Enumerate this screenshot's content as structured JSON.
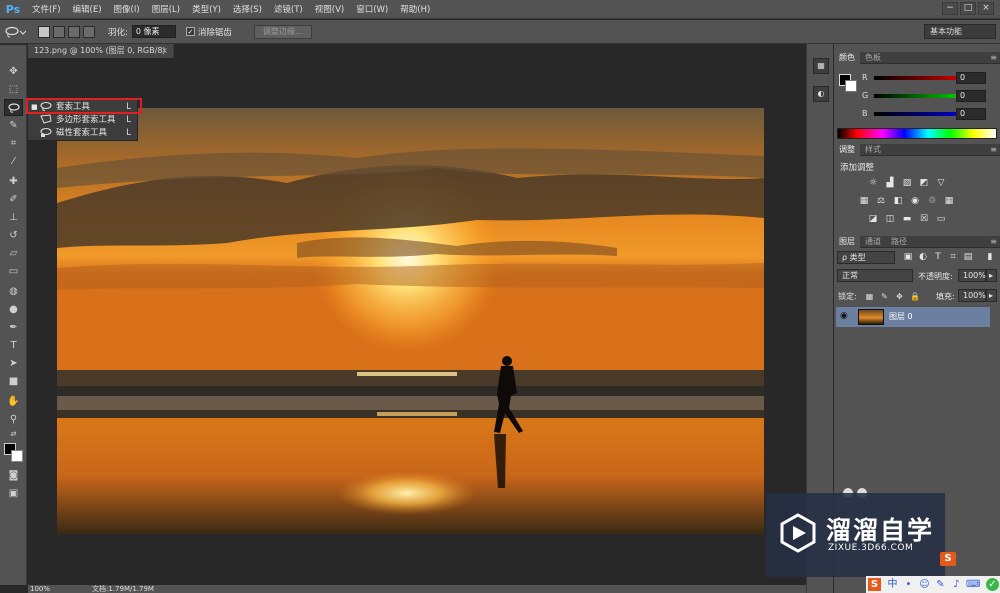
{
  "app": {
    "logo": "Ps"
  },
  "menubar": {
    "items": [
      "文件(F)",
      "编辑(E)",
      "图像(I)",
      "图层(L)",
      "类型(Y)",
      "选择(S)",
      "滤镜(T)",
      "视图(V)",
      "窗口(W)",
      "帮助(H)"
    ],
    "window_controls": [
      "−",
      "□",
      "×"
    ]
  },
  "options": {
    "feather_label": "羽化:",
    "feather_value": "0 像素",
    "antialias_label": "消除锯齿",
    "antialias_checked": true,
    "refine_edge_label": "调整边缘...",
    "workspace": "基本功能"
  },
  "document": {
    "tab_title": "123.png @ 100% (图层 0, RGB/8)",
    "tab_close": "×"
  },
  "flyout": {
    "items": [
      {
        "label": "套索工具",
        "shortcut": "L",
        "icon": "lasso-icon",
        "current": true
      },
      {
        "label": "多边形套索工具",
        "shortcut": "L",
        "icon": "polygonal-lasso-icon",
        "current": false
      },
      {
        "label": "磁性套索工具",
        "shortcut": "L",
        "icon": "magnetic-lasso-icon",
        "current": false
      }
    ]
  },
  "statusbar": {
    "zoom": "100%",
    "doc_info": "文档:1.79M/1.79M"
  },
  "color_panel": {
    "tabs": [
      "颜色",
      "色板"
    ],
    "channels": [
      {
        "label": "R",
        "value": "0"
      },
      {
        "label": "G",
        "value": "0"
      },
      {
        "label": "B",
        "value": "0"
      }
    ]
  },
  "adjustments_panel": {
    "tabs": [
      "调整",
      "样式"
    ],
    "title": "添加调整"
  },
  "layers_panel": {
    "tabs": [
      "图层",
      "通道",
      "路径"
    ],
    "filter_label": "ρ 类型",
    "blend_mode": "正常",
    "opacity_label": "不透明度:",
    "opacity_value": "100%",
    "lock_label": "锁定:",
    "fill_label": "填充:",
    "fill_value": "100%",
    "layers": [
      {
        "name": "图层 0",
        "visible": true
      }
    ]
  },
  "watermark": {
    "title": "溜溜自学",
    "subtitle": "ZIXUE.3D66.COM"
  },
  "colors": {
    "highlight": "#e02020",
    "ps_blue": "#4fb3f5",
    "layer_selected": "#6b7fa0"
  }
}
